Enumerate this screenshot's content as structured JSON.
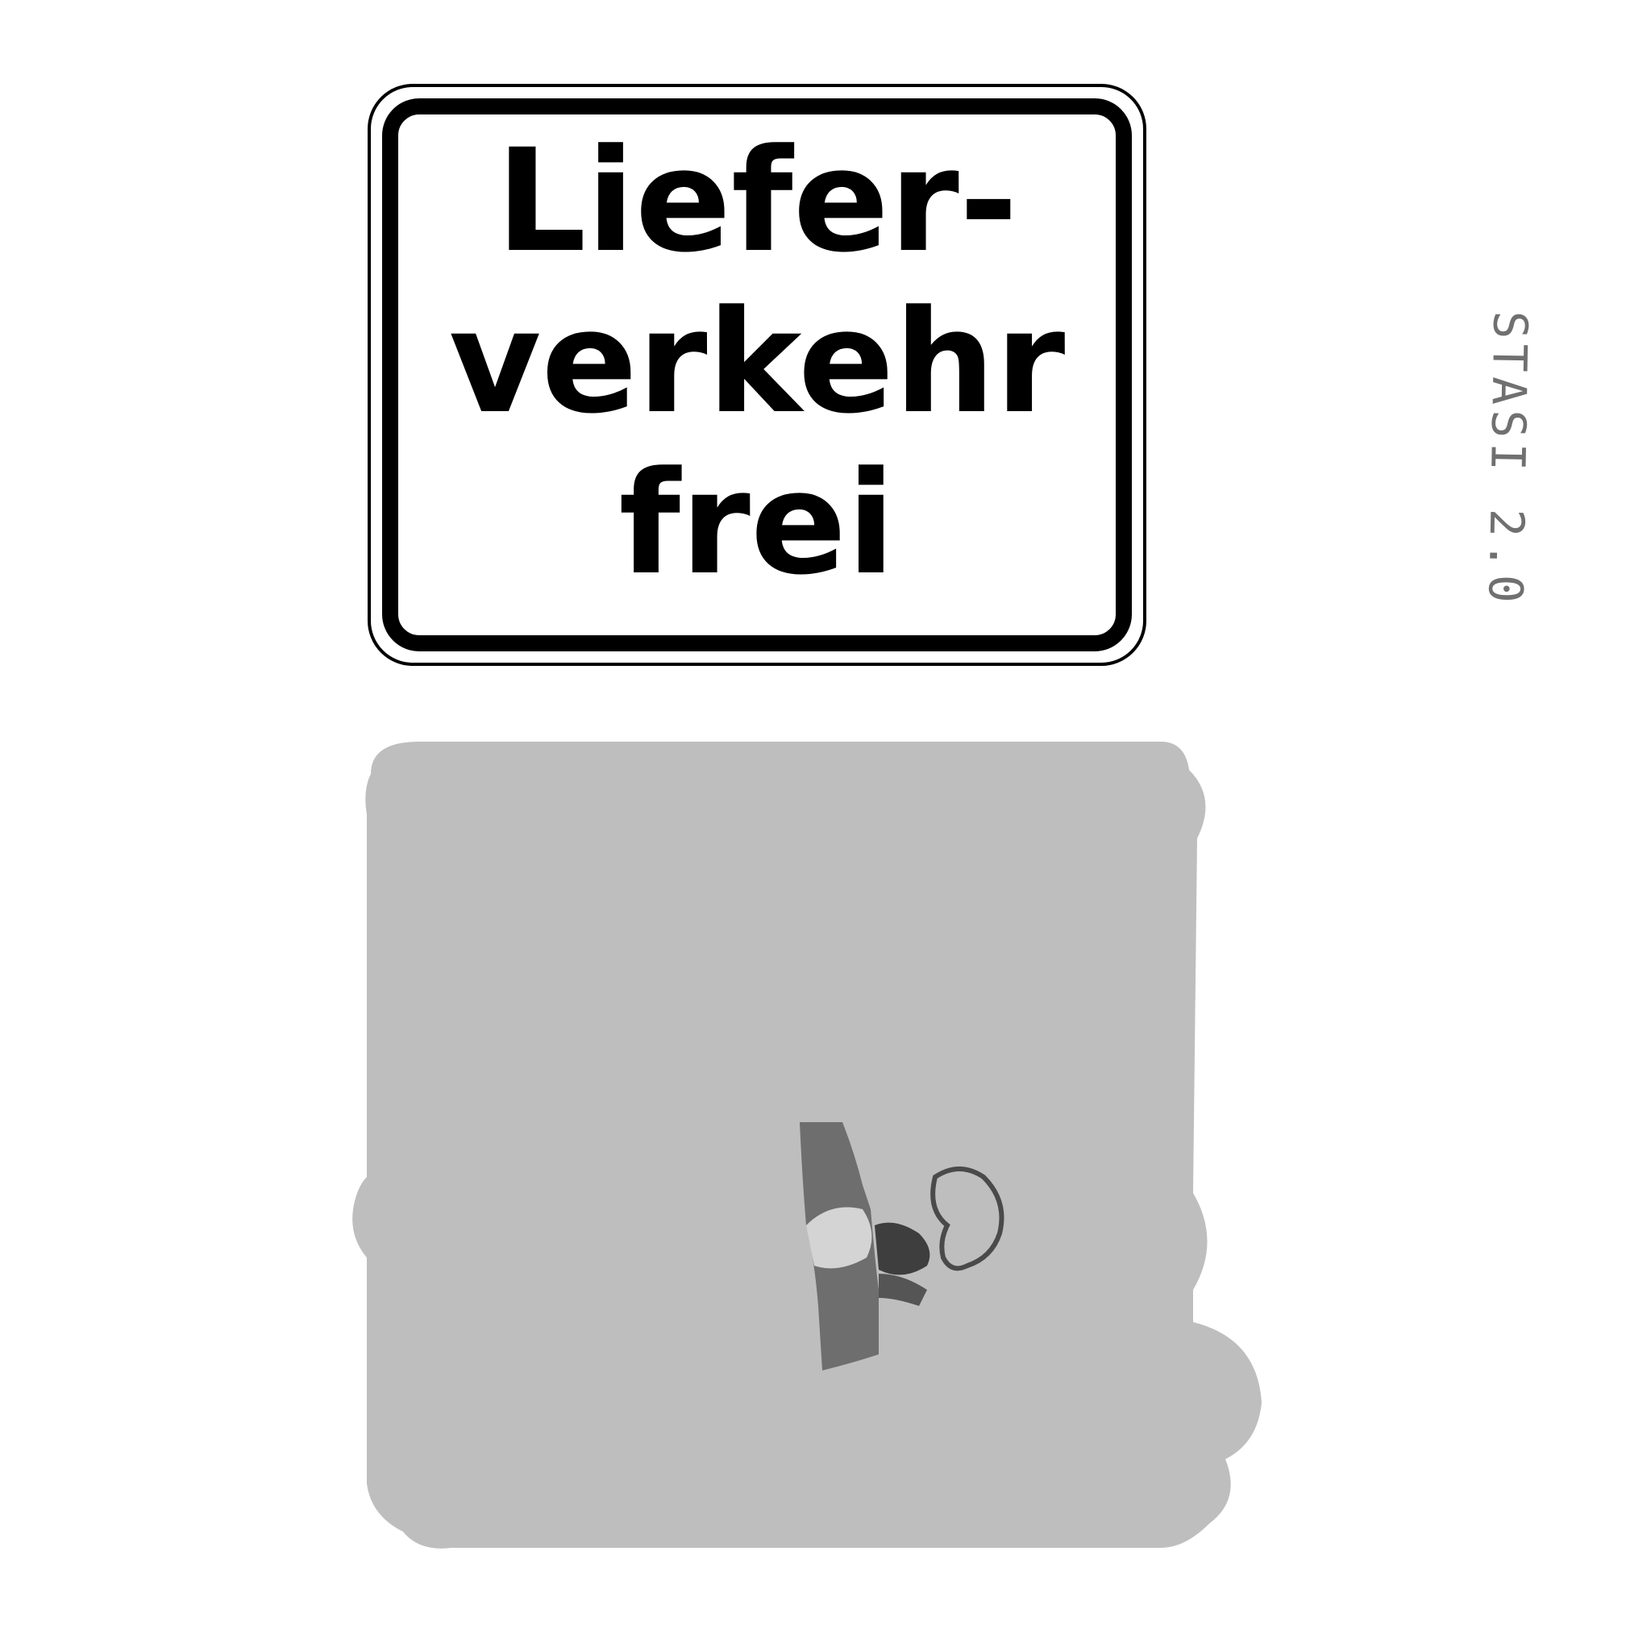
{
  "sign": {
    "lines": [
      "Liefer-",
      "verkehr",
      "frei"
    ],
    "text_color": "#000000",
    "background_color": "#ffffff",
    "border_color": "#000000"
  },
  "sticker": {
    "text": "STASI 2.0",
    "background_color": "#bebebe",
    "ink_color": "#585858",
    "figure": "portrait-stencil"
  }
}
